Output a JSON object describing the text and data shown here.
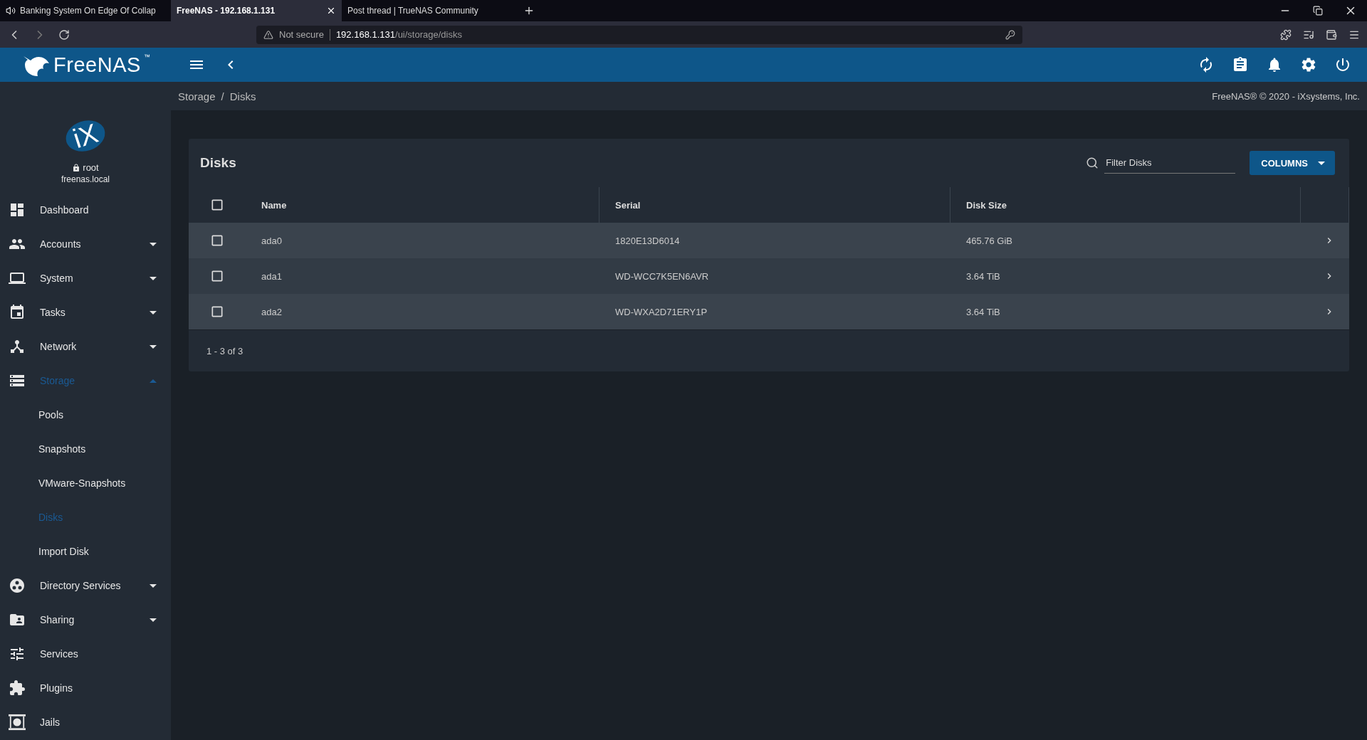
{
  "browser": {
    "tabs": [
      {
        "title": "Banking System On Edge Of Collap",
        "selected": false,
        "audio": true
      },
      {
        "title": "FreeNAS - 192.168.1.131",
        "selected": true,
        "audio": false
      },
      {
        "title": "Post thread | TrueNAS Community",
        "selected": false,
        "audio": false
      }
    ],
    "address": {
      "security": "Not secure",
      "host": "192.168.1.131",
      "path": "/ui/storage/disks"
    }
  },
  "header": {
    "brand": "FreeNAS",
    "trademark": "™"
  },
  "user": {
    "logo": "iX",
    "name": "root",
    "host": "freenas.local"
  },
  "nav": [
    {
      "label": "Dashboard",
      "kind": "link",
      "selected": false
    },
    {
      "label": "Accounts",
      "kind": "group",
      "expanded": false,
      "selected": false
    },
    {
      "label": "System",
      "kind": "group",
      "expanded": false,
      "selected": false
    },
    {
      "label": "Tasks",
      "kind": "group",
      "expanded": false,
      "selected": false
    },
    {
      "label": "Network",
      "kind": "group",
      "expanded": false,
      "selected": false
    },
    {
      "label": "Storage",
      "kind": "group",
      "expanded": true,
      "selected": true,
      "children": [
        {
          "label": "Pools",
          "selected": false
        },
        {
          "label": "Snapshots",
          "selected": false
        },
        {
          "label": "VMware-Snapshots",
          "selected": false
        },
        {
          "label": "Disks",
          "selected": true
        },
        {
          "label": "Import Disk",
          "selected": false
        }
      ]
    },
    {
      "label": "Directory Services",
      "kind": "group",
      "expanded": false,
      "selected": false
    },
    {
      "label": "Sharing",
      "kind": "group",
      "expanded": false,
      "selected": false
    },
    {
      "label": "Services",
      "kind": "link",
      "selected": false
    },
    {
      "label": "Plugins",
      "kind": "link",
      "selected": false
    },
    {
      "label": "Jails",
      "kind": "link",
      "selected": false
    }
  ],
  "breadcrumb": {
    "separator": "/",
    "items": [
      "Storage",
      "Disks"
    ]
  },
  "copyright": "FreeNAS® © 2020 - iXsystems, Inc.",
  "card": {
    "title": "Disks",
    "filter": {
      "placeholder": "Filter Disks"
    },
    "columns_button": "COLUMNS",
    "table": {
      "all_checked": false,
      "columns": [
        "Name",
        "Serial",
        "Disk Size"
      ],
      "rows": [
        {
          "checked": false,
          "cells": [
            "ada0",
            "1820E13D6014",
            "465.76 GiB"
          ]
        },
        {
          "checked": false,
          "cells": [
            "ada1",
            "WD-WCC7K5EN6AVR",
            "3.64 TiB"
          ]
        },
        {
          "checked": false,
          "cells": [
            "ada2",
            "WD-WXA2D71ERY1P",
            "3.64 TiB"
          ]
        }
      ]
    },
    "pager": "1 - 3 of 3"
  }
}
